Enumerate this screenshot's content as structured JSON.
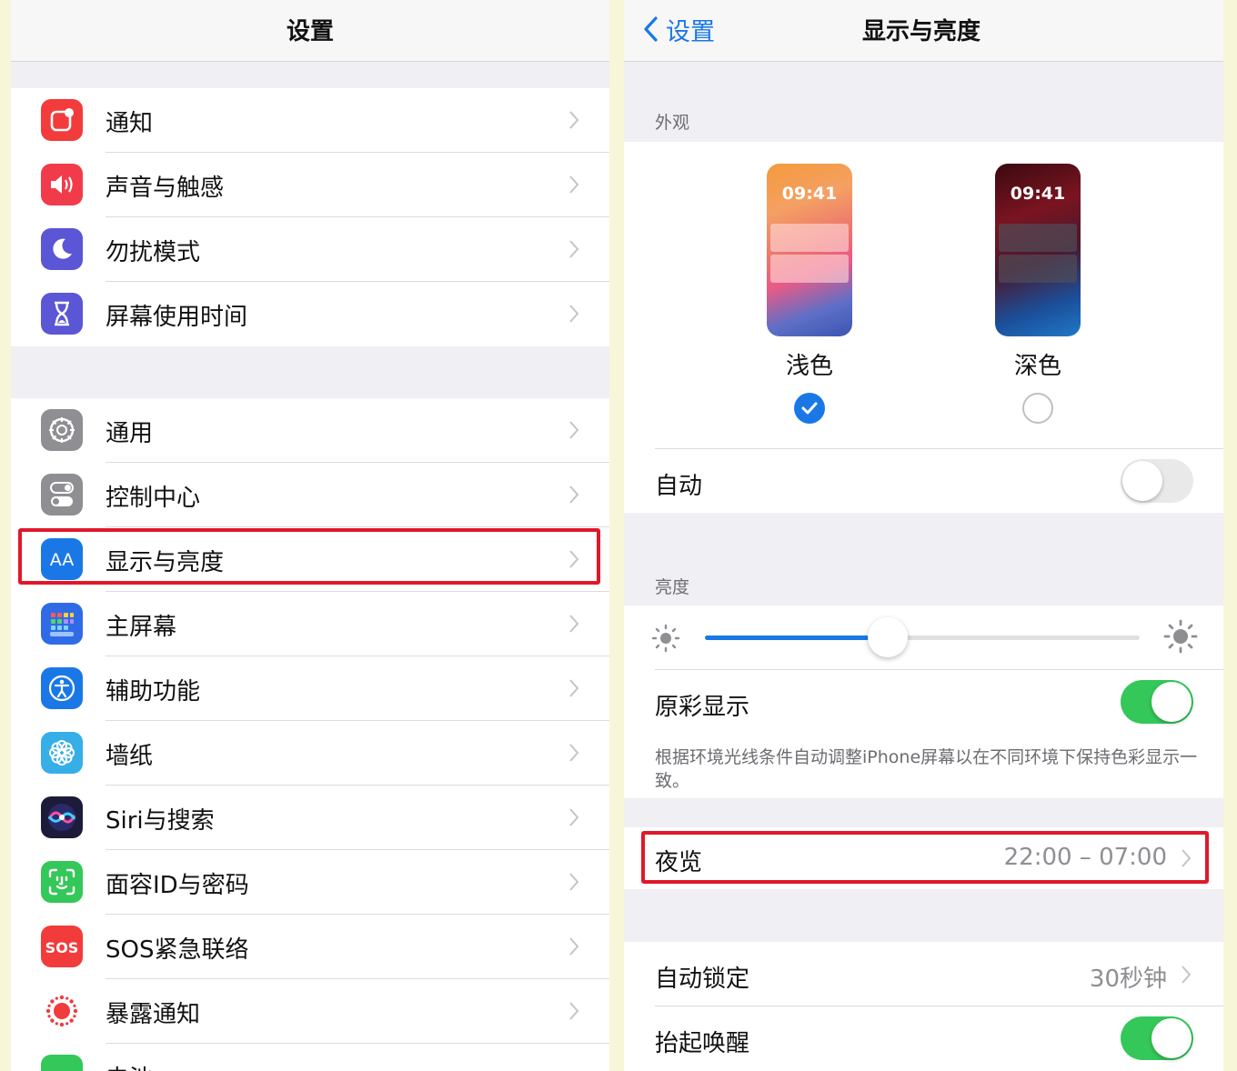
{
  "left": {
    "title": "设置",
    "items": [
      {
        "label": "通知",
        "icon": "notifications-icon",
        "color": "#f23b3b"
      },
      {
        "label": "声音与触感",
        "icon": "speaker-icon",
        "color": "#f23b4a"
      },
      {
        "label": "勿扰模式",
        "icon": "moon-icon",
        "color": "#5a56d6"
      },
      {
        "label": "屏幕使用时间",
        "icon": "hourglass-icon",
        "color": "#5a56d6"
      },
      {
        "label": "通用",
        "icon": "gear-icon",
        "color": "#8e8e93"
      },
      {
        "label": "控制中心",
        "icon": "toggles-icon",
        "color": "#8e8e93"
      },
      {
        "label": "显示与亮度",
        "icon": "aa-icon",
        "color": "#1a78e6"
      },
      {
        "label": "主屏幕",
        "icon": "home-grid-icon",
        "color": "#2f6be6"
      },
      {
        "label": "辅助功能",
        "icon": "accessibility-icon",
        "color": "#1a78e6"
      },
      {
        "label": "墙纸",
        "icon": "flower-icon",
        "color": "#36aee8"
      },
      {
        "label": "Siri与搜索",
        "icon": "siri-icon",
        "color": "#1c1c3a"
      },
      {
        "label": "面容ID与密码",
        "icon": "faceid-icon",
        "color": "#34c759"
      },
      {
        "label": "SOS紧急联络",
        "icon": "sos-icon",
        "color": "#f23b3b"
      },
      {
        "label": "暴露通知",
        "icon": "exposure-icon",
        "color": "#ffffff"
      },
      {
        "label": "电池",
        "icon": "battery-icon",
        "color": "#34c759"
      }
    ]
  },
  "right": {
    "back_label": "设置",
    "title": "显示与亮度",
    "appearance_header": "外观",
    "light": {
      "time": "09:41",
      "label": "浅色",
      "selected": true
    },
    "dark": {
      "time": "09:41",
      "label": "深色",
      "selected": false
    },
    "auto_label": "自动",
    "auto_on": false,
    "brightness_header": "亮度",
    "brightness_level": 0.42,
    "true_tone_label": "原彩显示",
    "true_tone_on": true,
    "true_tone_desc": "根据环境光线条件自动调整iPhone屏幕以在不同环境下保持色彩显示一致。",
    "night_shift_label": "夜览",
    "night_shift_value": "22:00 – 07:00",
    "auto_lock_label": "自动锁定",
    "auto_lock_value": "30秒钟",
    "raise_to_wake_label": "抬起唤醒",
    "raise_to_wake_on": true
  },
  "colors": {
    "accent": "#1a78e6",
    "highlight": "#e0182a",
    "toggle_on": "#34c759"
  }
}
